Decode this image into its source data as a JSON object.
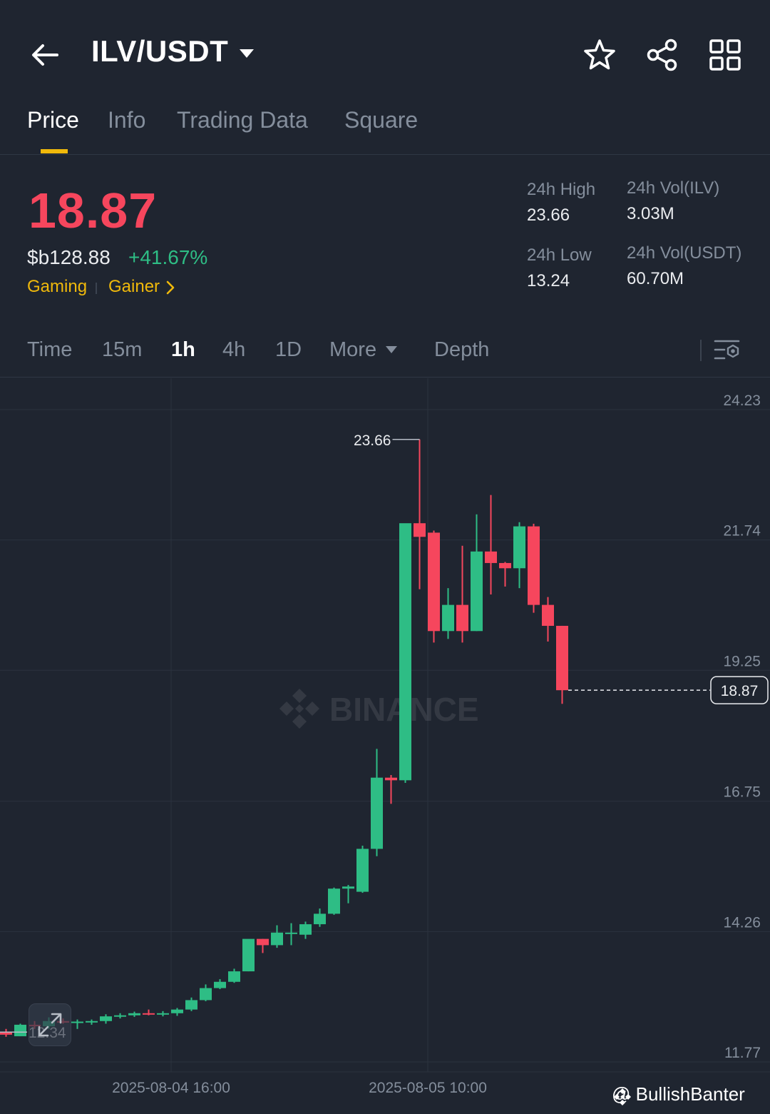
{
  "header": {
    "back_icon": "arrow-left-icon",
    "pair": "ILV/USDT",
    "icons": [
      "star-icon",
      "share-icon",
      "grid-icon"
    ]
  },
  "tabs": [
    {
      "label": "Price",
      "active": true
    },
    {
      "label": "Info",
      "active": false
    },
    {
      "label": "Trading Data",
      "active": false
    },
    {
      "label": "Square",
      "active": false
    }
  ],
  "price": {
    "last": "18.87",
    "fiat": "$b128.88",
    "change": "+41.67%",
    "tags": [
      "Gaming",
      "Gainer"
    ]
  },
  "stats": {
    "high_label": "24h High",
    "high_value": "23.66",
    "vol_base_label": "24h Vol(ILV)",
    "vol_base_value": "3.03M",
    "low_label": "24h Low",
    "low_value": "13.24",
    "vol_quote_label": "24h Vol(USDT)",
    "vol_quote_value": "60.70M"
  },
  "intervals": {
    "items": [
      "Time",
      "15m",
      "1h",
      "4h",
      "1D"
    ],
    "active": "1h",
    "more": "More",
    "depth": "Depth"
  },
  "colors": {
    "up": "#2ebd85",
    "down": "#f6465d",
    "accent": "#f0b90b",
    "background": "#1f2530"
  },
  "chart_data": {
    "type": "candlestick",
    "y_ticks": [
      "24.23",
      "21.74",
      "19.25",
      "16.75",
      "14.26",
      "11.77"
    ],
    "ylim": [
      11.77,
      24.23
    ],
    "x_ticks": [
      "2025-08-04 16:00",
      "2025-08-05 10:00"
    ],
    "high_marker": "23.66",
    "low_marker": "12.34",
    "last_price": "18.87",
    "watermark": "BINANCE",
    "grid": true,
    "series": [
      {
        "o": 12.33,
        "h": 12.4,
        "l": 12.25,
        "c": 12.29
      },
      {
        "o": 12.26,
        "h": 12.5,
        "l": 12.26,
        "c": 12.48
      },
      {
        "o": 12.48,
        "h": 12.55,
        "l": 12.4,
        "c": 12.45
      },
      {
        "o": 12.45,
        "h": 12.62,
        "l": 12.4,
        "c": 12.55
      },
      {
        "o": 12.55,
        "h": 12.6,
        "l": 12.5,
        "c": 12.52
      },
      {
        "o": 12.52,
        "h": 12.58,
        "l": 12.4,
        "c": 12.54
      },
      {
        "o": 12.54,
        "h": 12.58,
        "l": 12.48,
        "c": 12.55
      },
      {
        "o": 12.55,
        "h": 12.68,
        "l": 12.5,
        "c": 12.64
      },
      {
        "o": 12.64,
        "h": 12.7,
        "l": 12.6,
        "c": 12.66
      },
      {
        "o": 12.66,
        "h": 12.73,
        "l": 12.63,
        "c": 12.7
      },
      {
        "o": 12.7,
        "h": 12.77,
        "l": 12.66,
        "c": 12.68
      },
      {
        "o": 12.68,
        "h": 12.74,
        "l": 12.64,
        "c": 12.7
      },
      {
        "o": 12.7,
        "h": 12.8,
        "l": 12.65,
        "c": 12.77
      },
      {
        "o": 12.77,
        "h": 13.0,
        "l": 12.74,
        "c": 12.95
      },
      {
        "o": 12.95,
        "h": 13.25,
        "l": 12.93,
        "c": 13.18
      },
      {
        "o": 13.18,
        "h": 13.35,
        "l": 13.16,
        "c": 13.3
      },
      {
        "o": 13.3,
        "h": 13.55,
        "l": 13.28,
        "c": 13.5
      },
      {
        "o": 13.5,
        "h": 14.1,
        "l": 13.5,
        "c": 14.12
      },
      {
        "o": 14.12,
        "h": 14.12,
        "l": 13.85,
        "c": 14.0
      },
      {
        "o": 14.0,
        "h": 14.38,
        "l": 13.95,
        "c": 14.24
      },
      {
        "o": 14.24,
        "h": 14.42,
        "l": 14.0,
        "c": 14.24
      },
      {
        "o": 14.2,
        "h": 14.45,
        "l": 14.12,
        "c": 14.4
      },
      {
        "o": 14.4,
        "h": 14.7,
        "l": 14.35,
        "c": 14.6
      },
      {
        "o": 14.6,
        "h": 15.1,
        "l": 14.58,
        "c": 15.08
      },
      {
        "o": 15.08,
        "h": 15.15,
        "l": 14.8,
        "c": 15.12
      },
      {
        "o": 15.02,
        "h": 15.9,
        "l": 15.0,
        "c": 15.84
      },
      {
        "o": 15.84,
        "h": 17.75,
        "l": 15.7,
        "c": 17.2
      },
      {
        "o": 17.2,
        "h": 17.25,
        "l": 16.7,
        "c": 17.15
      },
      {
        "o": 17.15,
        "h": 22.05,
        "l": 17.1,
        "c": 22.06
      },
      {
        "o": 22.06,
        "h": 23.66,
        "l": 20.8,
        "c": 21.8
      },
      {
        "o": 21.88,
        "h": 21.92,
        "l": 19.78,
        "c": 20.0
      },
      {
        "o": 20.0,
        "h": 20.82,
        "l": 19.85,
        "c": 20.5
      },
      {
        "o": 20.5,
        "h": 21.63,
        "l": 19.78,
        "c": 20.0
      },
      {
        "o": 20.0,
        "h": 22.23,
        "l": 20.0,
        "c": 21.52
      },
      {
        "o": 21.52,
        "h": 22.6,
        "l": 20.7,
        "c": 21.3
      },
      {
        "o": 21.3,
        "h": 21.32,
        "l": 20.85,
        "c": 21.2
      },
      {
        "o": 21.2,
        "h": 22.08,
        "l": 20.82,
        "c": 22.0
      },
      {
        "o": 22.0,
        "h": 22.05,
        "l": 20.35,
        "c": 20.5
      },
      {
        "o": 20.5,
        "h": 20.65,
        "l": 19.8,
        "c": 20.1
      },
      {
        "o": 20.1,
        "h": 20.1,
        "l": 18.61,
        "c": 18.87
      }
    ]
  },
  "credit": "@ BullishBanter"
}
